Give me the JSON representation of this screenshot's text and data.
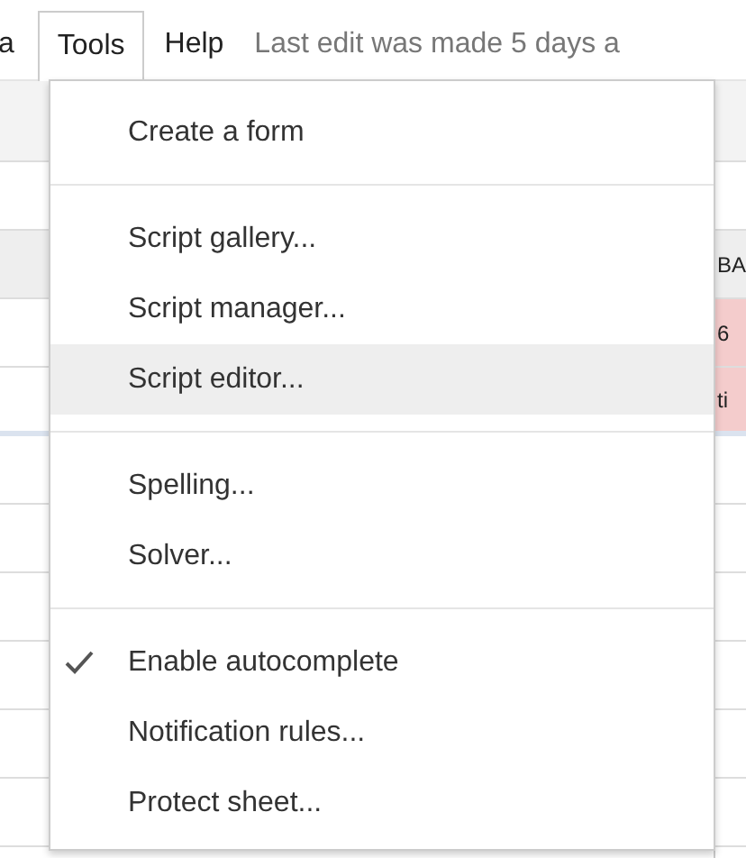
{
  "menubar": {
    "items": [
      {
        "label": "a",
        "selected": false
      },
      {
        "label": "Tools",
        "selected": true
      },
      {
        "label": "Help",
        "selected": false
      }
    ],
    "status": "Last edit was made 5 days a"
  },
  "sheet": {
    "right_cells": [
      "BA",
      "6",
      "ti"
    ]
  },
  "menu": {
    "items": [
      {
        "kind": "item",
        "label": "Create a form",
        "checked": false,
        "selected": false
      },
      {
        "kind": "separator"
      },
      {
        "kind": "item",
        "label": "Script gallery...",
        "checked": false,
        "selected": false
      },
      {
        "kind": "item",
        "label": "Script manager...",
        "checked": false,
        "selected": false
      },
      {
        "kind": "item",
        "label": "Script editor...",
        "checked": false,
        "selected": true
      },
      {
        "kind": "separator"
      },
      {
        "kind": "item",
        "label": "Spelling...",
        "checked": false,
        "selected": false
      },
      {
        "kind": "item",
        "label": "Solver...",
        "checked": false,
        "selected": false
      },
      {
        "kind": "separator"
      },
      {
        "kind": "item",
        "label": "Enable autocomplete",
        "checked": true,
        "selected": false
      },
      {
        "kind": "item",
        "label": "Notification rules...",
        "checked": false,
        "selected": false
      },
      {
        "kind": "item",
        "label": "Protect sheet...",
        "checked": false,
        "selected": false
      }
    ]
  }
}
